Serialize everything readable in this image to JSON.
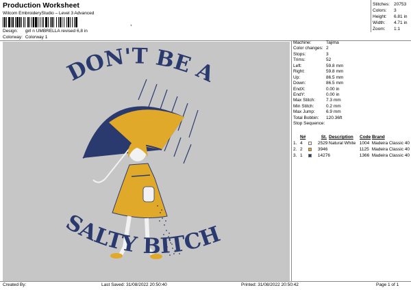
{
  "header": {
    "title": "Production Worksheet",
    "subtitle": "Wilcom EmbroideryStudio – Level 3 Advanced",
    "barcode_trailer": ","
  },
  "meta": {
    "design_label": "Design:",
    "design_value": "girl n UMBRELLA revised 6,8 in",
    "colorway_label": "Colorway:",
    "colorway_value": "Colorway 1"
  },
  "stats": [
    {
      "label": "Stitches:",
      "value": "20753"
    },
    {
      "label": "Colors:",
      "value": "3"
    },
    {
      "label": "Height:",
      "value": "6.81 in"
    },
    {
      "label": "Width:",
      "value": "4.71 in"
    },
    {
      "label": "Zoom:",
      "value": "1:1"
    }
  ],
  "design": {
    "top_text": "DON'T BE A",
    "bottom_text": "SALTY BITCH",
    "colors": {
      "background": "#c6c6c6",
      "navy": "#2b3a6e",
      "gold": "#e0a92a",
      "white": "#f2f2f2"
    }
  },
  "machine": [
    {
      "label": "Machine:",
      "value": "Tajima"
    },
    {
      "label": "Color changes:",
      "value": "2"
    },
    {
      "label": "Stops:",
      "value": "3"
    },
    {
      "label": "Trims:",
      "value": "52"
    },
    {
      "label": "Left:",
      "value": "59.8 mm"
    },
    {
      "label": "Right:",
      "value": "59.8 mm"
    },
    {
      "label": "Up:",
      "value": "86.5 mm"
    },
    {
      "label": "Down:",
      "value": "86.5 mm"
    },
    {
      "label": "EndX:",
      "value": "0.00 in"
    },
    {
      "label": "EndY:",
      "value": "0.00 in"
    },
    {
      "label": "Max Stitch:",
      "value": "7.3 mm"
    },
    {
      "label": "Min Stitch:",
      "value": "0.2 mm"
    },
    {
      "label": "Max Jump:",
      "value": "6.9 mm"
    },
    {
      "label": "Total Bobbin:",
      "value": "120.36ft"
    },
    {
      "label": "Stop Sequence:",
      "value": ""
    }
  ],
  "stop_table": {
    "headers": [
      "N#",
      "St.",
      "Description",
      "Code",
      "Brand"
    ],
    "rows": [
      {
        "idx": "1.",
        "n": "4",
        "swatch": "#f2f2f2",
        "stitches": "2529",
        "description": "Natural White",
        "code": "1004",
        "brand": "Madeira Classic 40"
      },
      {
        "idx": "2.",
        "n": "2",
        "swatch": "#e0a92a",
        "stitches": "3946",
        "description": "",
        "code": "1125",
        "brand": "Madeira Classic 40"
      },
      {
        "idx": "3.",
        "n": "1",
        "swatch": "#2b3a6e",
        "stitches": "14276",
        "description": "",
        "code": "1366",
        "brand": "Madeira Classic 40"
      }
    ]
  },
  "footer": {
    "created_by": "Created By:",
    "last_saved": "Last Saved: 31/08/2022 20:50:40",
    "printed": "Printed: 31/08/2022 20:50:42",
    "page": "Page 1 of 1"
  }
}
